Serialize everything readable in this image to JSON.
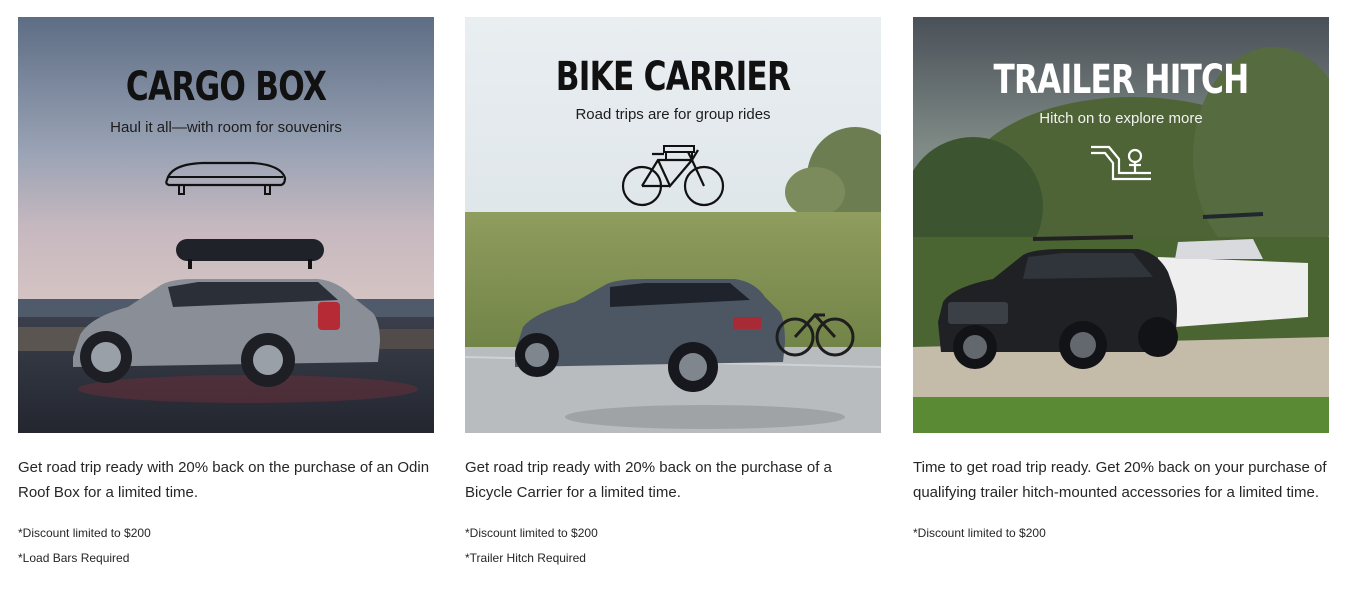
{
  "cards": [
    {
      "title": "CARGO BOX",
      "subtitle": "Haul it all—with room for souvenirs",
      "icon": "cargo-box-icon",
      "description": "Get road trip ready with 20% back on the purchase of an Odin Roof Box for a limited time.",
      "notes": [
        "*Discount limited to $200",
        "*Load Bars Required"
      ]
    },
    {
      "title": "BIKE CARRIER",
      "subtitle": "Road trips are for group rides",
      "icon": "bicycle-icon",
      "description": "Get road trip ready with 20% back on the purchase of a Bicycle Carrier for a limited time.",
      "notes": [
        "*Discount limited to $200",
        "*Trailer Hitch Required"
      ]
    },
    {
      "title": "TRAILER HITCH",
      "subtitle": "Hitch on to explore more",
      "icon": "trailer-hitch-icon",
      "description": "Time to get road trip ready. Get 20% back on your purchase of qualifying trailer hitch-mounted accessories for a limited time.",
      "notes": [
        "*Discount limited to $200"
      ]
    }
  ]
}
